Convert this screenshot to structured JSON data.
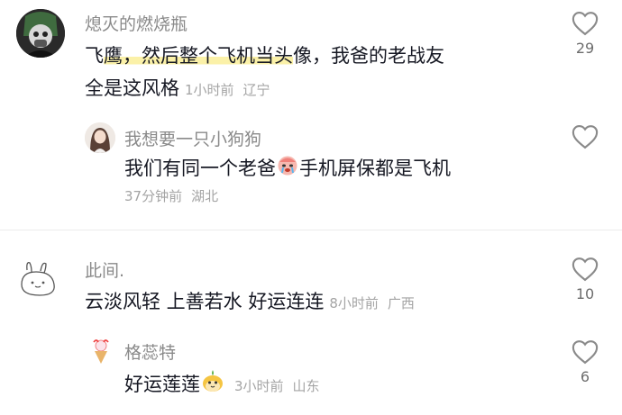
{
  "comments": [
    {
      "username": "熄灭的燃烧瓶",
      "text_part1": "飞",
      "text_highlight": "鹰，然后整个飞机当头",
      "text_part2": "像，我爸的老战友",
      "text_line2": "全是这风格",
      "time": "1小时前",
      "location": "辽宁",
      "likes": "29",
      "reply": {
        "username": "我想要一只小狗狗",
        "text_part1": "我们有同一个老爸",
        "text_part2": "手机屏保都是飞机",
        "time": "37分钟前",
        "location": "湖北",
        "likes": ""
      }
    },
    {
      "username": "此间.",
      "text": "云淡风轻 上善若水  好运连连",
      "time": "8小时前",
      "location": "广西",
      "likes": "10",
      "reply": {
        "username": "格蕊特",
        "text": "好运莲莲",
        "time": "3小时前",
        "location": "山东",
        "likes": "6"
      }
    }
  ],
  "icons": {
    "like": "heart-outline-icon",
    "emoji_crying": "crying-face-emoji",
    "emoji_lotus": "lotus-character-emoji"
  },
  "colors": {
    "username": "#8a8a8a",
    "text": "#161823",
    "meta": "#a4a4a4",
    "highlight": "#fbf1a8",
    "heart": "#8a8a8a"
  }
}
